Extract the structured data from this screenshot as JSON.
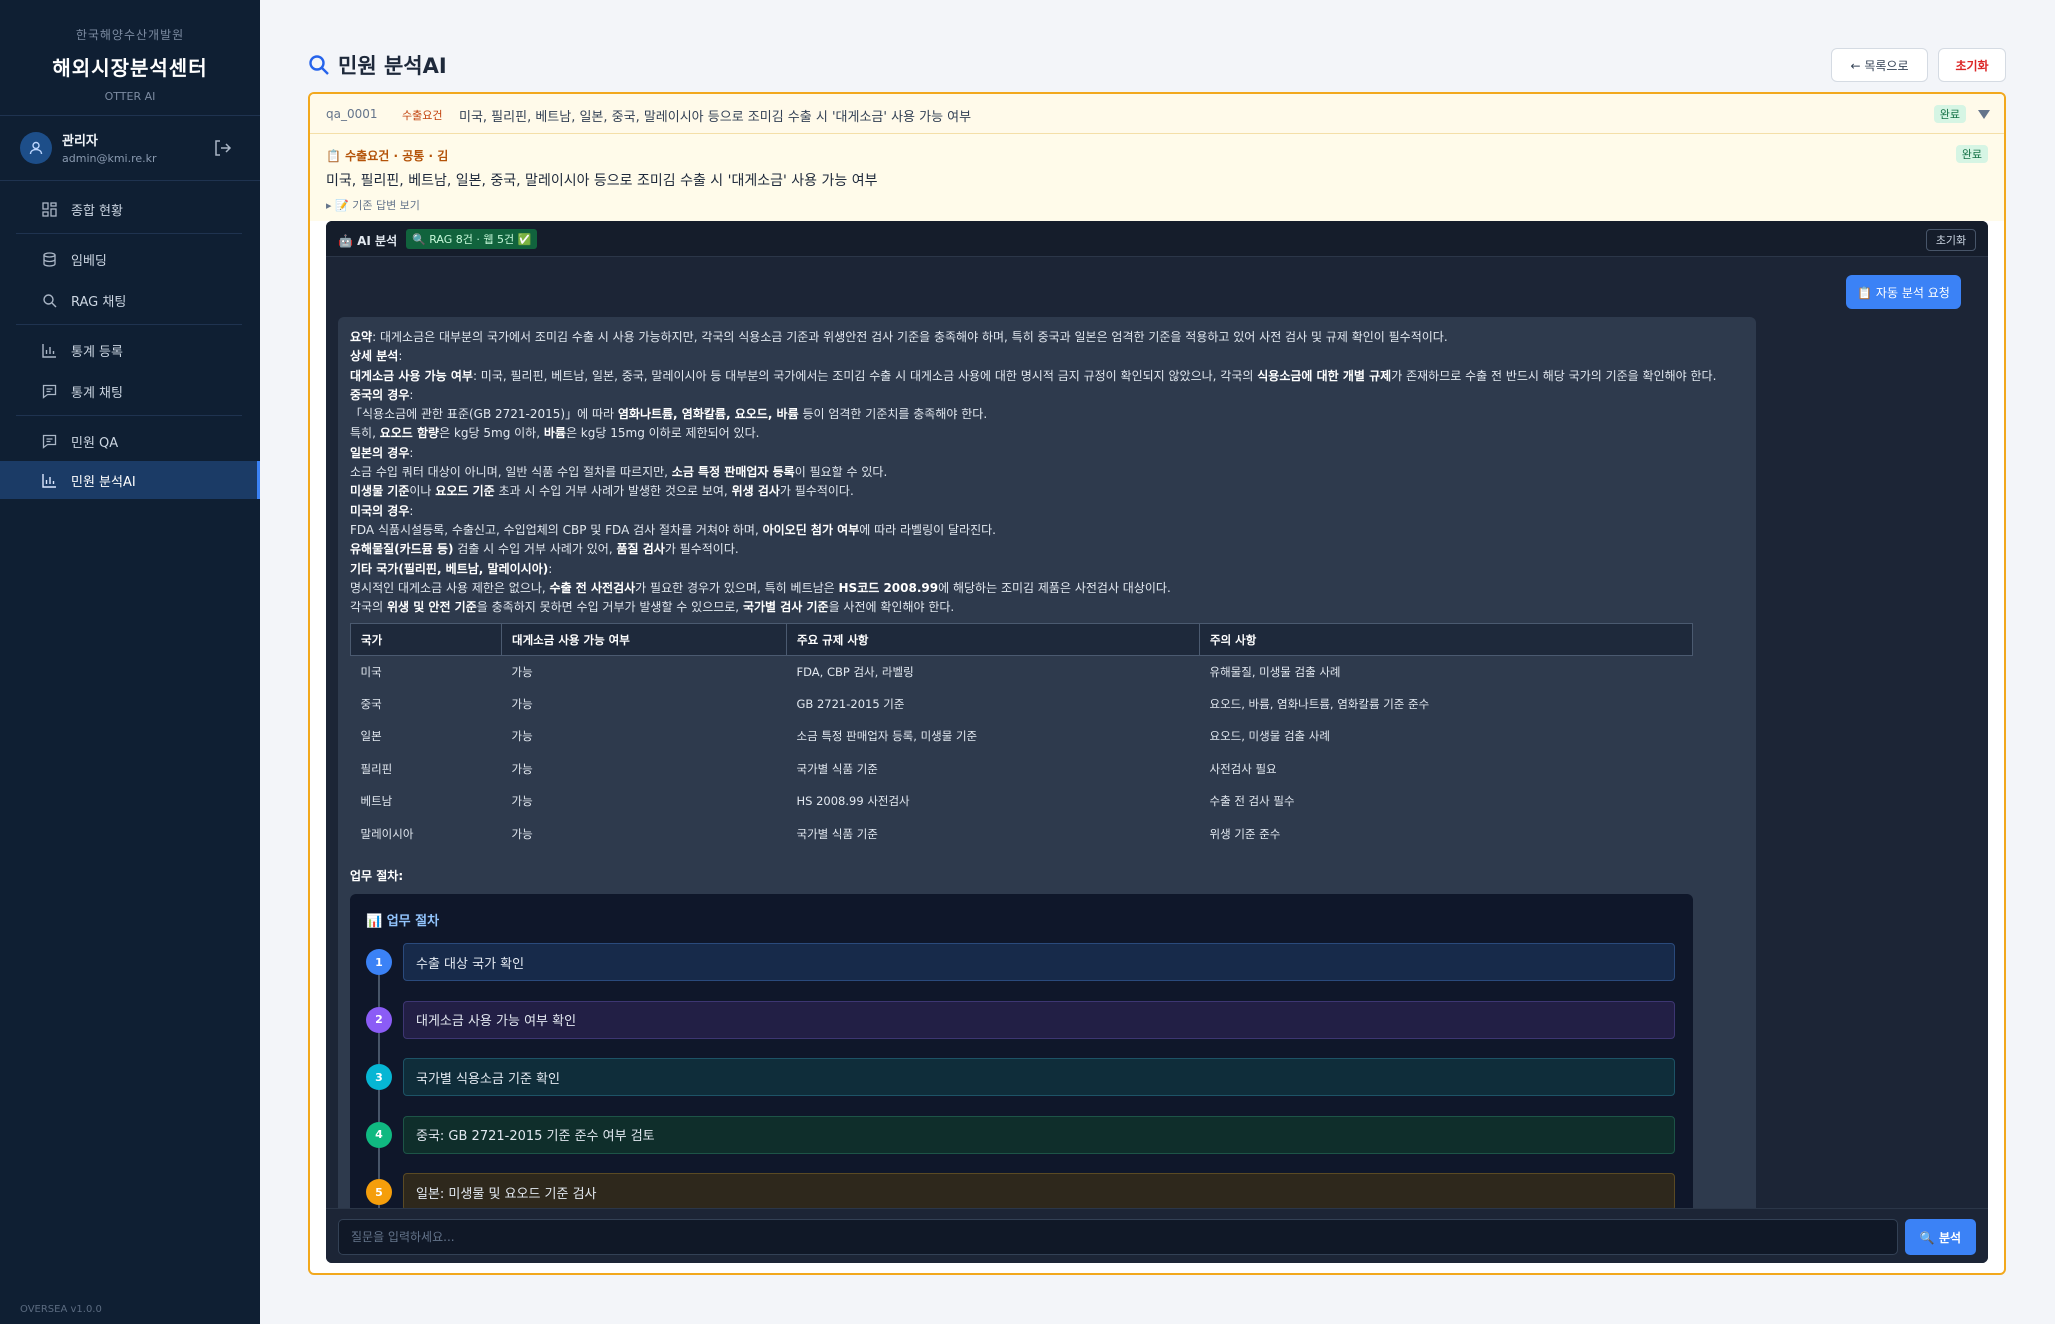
{
  "sidebar": {
    "org": "한국해양수산개발원",
    "title": "해외시장분석센터",
    "tagline": "OTTER AI",
    "user": {
      "name": "관리자",
      "email": "admin@kmi.re.kr"
    },
    "items": [
      {
        "label": "종합 현황",
        "icon": "dashboard-icon"
      },
      {
        "label": "임베딩",
        "icon": "database-icon"
      },
      {
        "label": "RAG 채팅",
        "icon": "search-icon"
      },
      {
        "label": "통계 등록",
        "icon": "bar-chart-icon"
      },
      {
        "label": "통계 채팅",
        "icon": "chat-icon"
      },
      {
        "label": "민원 QA",
        "icon": "chat-icon"
      },
      {
        "label": "민원 분석AI",
        "icon": "bar-chart-icon"
      }
    ],
    "active_index": 6,
    "version": "OVERSEA v1.0.0"
  },
  "header": {
    "title": "민원 분석AI",
    "back_label": "← 목록으로",
    "reset_label": "초기화"
  },
  "qa": {
    "id": "qa_0001",
    "category": "수출요건",
    "title": "미국, 필리핀, 베트남, 일본, 중국, 말레이시아 등으로 조미김 수출 시 '대게소금' 사용 가능 여부",
    "status": "완료",
    "info_category": "📋 수출요건 · 공통 · 김",
    "question": "미국, 필리핀, 베트남, 일본, 중국, 말레이시아 등으로 조미김 수출 시 '대게소금' 사용 가능 여부",
    "toggle_label": "▸ 📝 기존 답변 보기"
  },
  "ai": {
    "panel_title": "🤖 AI 분석",
    "rag_badge": "🔍 RAG 8건 · 웹 5건 ✅",
    "reset_label": "초기화",
    "auto_label": "📋 자동 분석 요청",
    "lines": [
      [
        {
          "b": "요약"
        },
        {
          "t": ": 대게소금은 대부분의 국가에서 조미김 수출 시 사용 가능하지만, 각국의 식용소금 기준과 위생안전 검사 기준을 충족해야 하며, 특히 중국과 일본은 엄격한 기준을 적용하고 있어 사전 검사 및 규제 확인이 필수적이다."
        }
      ],
      [
        {
          "b": "상세 분석"
        },
        {
          "t": ":"
        }
      ],
      [
        {
          "b": "대게소금 사용 가능 여부"
        },
        {
          "t": ": 미국, 필리핀, 베트남, 일본, 중국, 말레이시아 등 대부분의 국가에서는 조미김 수출 시 대게소금 사용에 대한 명시적 금지 규정이 확인되지 않았으나, 각국의 "
        },
        {
          "b": "식용소금에 대한 개별 규제"
        },
        {
          "t": "가 존재하므로 수출 전 반드시 해당 국가의 기준을 확인해야 한다."
        }
      ],
      [
        {
          "b": "중국의 경우"
        },
        {
          "t": ":"
        }
      ],
      [
        {
          "t": "「식용소금에 관한 표준(GB 2721-2015)」에 따라 "
        },
        {
          "b": "염화나트륨, 염화칼륨, 요오드, 바륨"
        },
        {
          "t": " 등이 엄격한 기준치를 충족해야 한다."
        }
      ],
      [
        {
          "t": "특히, "
        },
        {
          "b": "요오드 함량"
        },
        {
          "t": "은 kg당 5mg 이하, "
        },
        {
          "b": "바륨"
        },
        {
          "t": "은 kg당 15mg 이하로 제한되어 있다."
        }
      ],
      [
        {
          "b": "일본의 경우"
        },
        {
          "t": ":"
        }
      ],
      [
        {
          "t": "소금 수입 쿼터 대상이 아니며, 일반 식품 수입 절차를 따르지만, "
        },
        {
          "b": "소금 특정 판매업자 등록"
        },
        {
          "t": "이 필요할 수 있다."
        }
      ],
      [
        {
          "b": "미생물 기준"
        },
        {
          "t": "이나 "
        },
        {
          "b": "요오드 기준"
        },
        {
          "t": " 초과 시 수입 거부 사례가 발생한 것으로 보여, "
        },
        {
          "b": "위생 검사"
        },
        {
          "t": "가 필수적이다."
        }
      ],
      [
        {
          "b": "미국의 경우"
        },
        {
          "t": ":"
        }
      ],
      [
        {
          "t": "FDA 식품시설등록, 수출신고, 수입업체의 CBP 및 FDA 검사 절차를 거쳐야 하며, "
        },
        {
          "b": "아이오딘 첨가 여부"
        },
        {
          "t": "에 따라 라벨링이 달라진다."
        }
      ],
      [
        {
          "b": "유해물질(카드뮴 등)"
        },
        {
          "t": " 검출 시 수입 거부 사례가 있어, "
        },
        {
          "b": "품질 검사"
        },
        {
          "t": "가 필수적이다."
        }
      ],
      [
        {
          "b": "기타 국가(필리핀, 베트남, 말레이시아)"
        },
        {
          "t": ":"
        }
      ],
      [
        {
          "t": "명시적인 대게소금 사용 제한은 없으나, "
        },
        {
          "b": "수출 전 사전검사"
        },
        {
          "t": "가 필요한 경우가 있으며, 특히 베트남은 "
        },
        {
          "b": "HS코드 2008.99"
        },
        {
          "t": "에 해당하는 조미김 제품은 사전검사 대상이다."
        }
      ],
      [
        {
          "t": "각국의 "
        },
        {
          "b": "위생 및 안전 기준"
        },
        {
          "t": "을 충족하지 못하면 수입 거부가 발생할 수 있으므로, "
        },
        {
          "b": "국가별 검사 기준"
        },
        {
          "t": "을 사전에 확인해야 한다."
        }
      ]
    ],
    "table": {
      "headers": [
        "국가",
        "대게소금 사용 가능 여부",
        "주요 규제 사항",
        "주의 사항"
      ],
      "rows": [
        [
          "미국",
          "가능",
          "FDA, CBP 검사, 라벨링",
          "유해물질, 미생물 검출 사례"
        ],
        [
          "중국",
          "가능",
          "GB 2721-2015 기준",
          "요오드, 바륨, 염화나트륨, 염화칼륨 기준 준수"
        ],
        [
          "일본",
          "가능",
          "소금 특정 판매업자 등록, 미생물 기준",
          "요오드, 미생물 검출 사례"
        ],
        [
          "필리핀",
          "가능",
          "국가별 식품 기준",
          "사전검사 필요"
        ],
        [
          "베트남",
          "가능",
          "HS 2008.99 사전검사",
          "수출 전 검사 필수"
        ],
        [
          "말레이시아",
          "가능",
          "국가별 식품 기준",
          "위생 기준 준수"
        ]
      ]
    },
    "process_label": "업무 절차:",
    "flow_title": "📊 업무 절차",
    "steps": [
      {
        "num": "1",
        "label": "수출 대상 국가 확인",
        "color": "#3b82f6",
        "bg": "#172a4a",
        "border": "#2a4a7c"
      },
      {
        "num": "2",
        "label": "대게소금 사용 가능 여부 확인",
        "color": "#8b5cf6",
        "bg": "#221f45",
        "border": "#3d3672"
      },
      {
        "num": "3",
        "label": "국가별 식용소금 기준 확인",
        "color": "#06b6d4",
        "bg": "#0f2d3a",
        "border": "#1d5366"
      },
      {
        "num": "4",
        "label": "중국: GB 2721-2015 기준 준수 여부 검토",
        "color": "#10b981",
        "bg": "#0f2e2b",
        "border": "#1d5447"
      },
      {
        "num": "5",
        "label": "일본: 미생물 및 요오드 기준 검사",
        "color": "#f59e0b",
        "bg": "#2e281c",
        "border": "#5a4a24"
      }
    ],
    "input_placeholder": "질문을 입력하세요...",
    "send_label": "🔍 분석"
  }
}
